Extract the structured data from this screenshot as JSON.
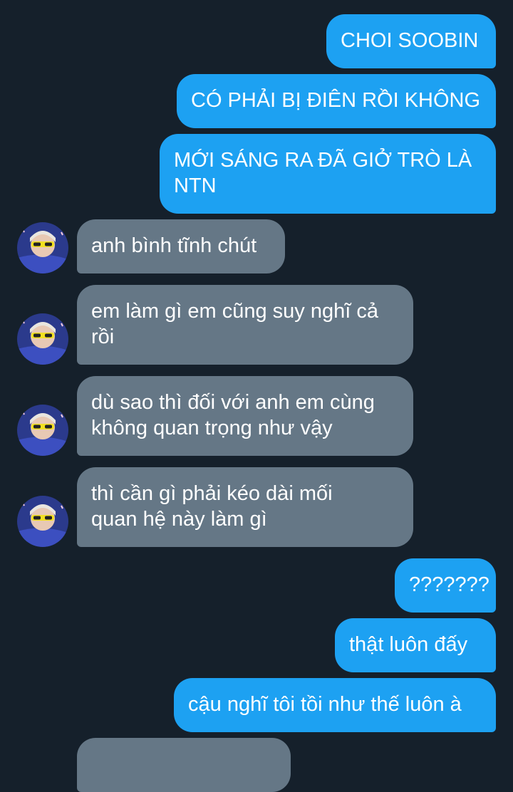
{
  "thread": {
    "messages": [
      {
        "side": "out",
        "text": "CHOI SOOBIN"
      },
      {
        "side": "out",
        "text": "CÓ PHẢI BỊ ĐIÊN RỒI KHÔNG"
      },
      {
        "side": "out",
        "text": "MỚI SÁNG RA ĐÃ GIỞ TRÒ LÀ\nNTN"
      },
      {
        "side": "in",
        "text": "anh bình tĩnh chút",
        "avatar": "avatar-photo"
      },
      {
        "side": "in",
        "text": "em làm gì em cũng suy nghĩ cả\nrồi",
        "avatar": "avatar-photo"
      },
      {
        "side": "in",
        "text": "dù sao thì đối với anh em cùng\nkhông quan trọng như vậy",
        "avatar": "avatar-photo"
      },
      {
        "side": "in",
        "text": "thì cần gì phải kéo dài mối\nquan hệ này làm gì",
        "avatar": "avatar-photo"
      },
      {
        "side": "out",
        "text": "???????"
      },
      {
        "side": "out",
        "text": "thật luôn đấy"
      },
      {
        "side": "out",
        "text": "cậu nghĩ tôi tồi như thế luôn à"
      }
    ]
  },
  "colors": {
    "background": "#15202b",
    "outgoing_bubble": "#1da1f2",
    "incoming_bubble": "#657786",
    "text": "#ffffff"
  }
}
